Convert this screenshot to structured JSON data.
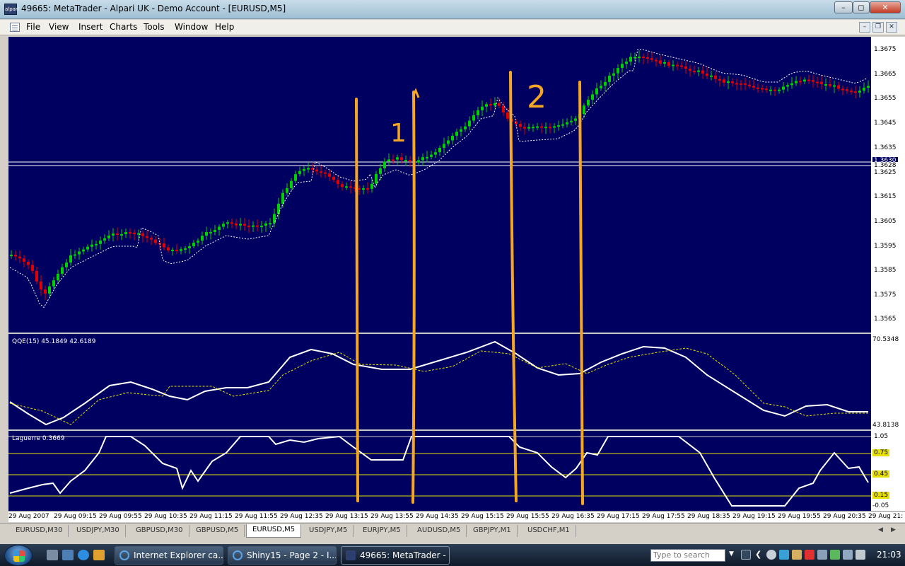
{
  "window": {
    "title": "49665: MetaTrader - Alpari UK - Demo Account - [EURUSD,M5]",
    "app_icon_text": "alpari"
  },
  "menu": [
    "File",
    "View",
    "Insert",
    "Charts",
    "Tools",
    "Window",
    "Help"
  ],
  "price_axis": {
    "labels": [
      "1.3675",
      "1.3665",
      "1.3655",
      "1.3645",
      "1.3635",
      "1.3630",
      "1.3628",
      "1.3625",
      "1.3615",
      "1.3605",
      "1.3595",
      "1.3585",
      "1.3575",
      "1.3565"
    ]
  },
  "qqe": {
    "label": "QQE(15) 45.1849 42.6189",
    "axis_max": "70.5348",
    "axis_min": "43.8138"
  },
  "laguerre": {
    "label": "Laguerre 0.3669",
    "levels": [
      "1.05",
      "0.75",
      "0.45",
      "0.15",
      "-0.05"
    ]
  },
  "time_axis": [
    "29 Aug 2007",
    "29 Aug 09:15",
    "29 Aug 09:55",
    "29 Aug 10:35",
    "29 Aug 11:15",
    "29 Aug 11:55",
    "29 Aug 12:35",
    "29 Aug 13:15",
    "29 Aug 13:55",
    "29 Aug 14:35",
    "29 Aug 15:15",
    "29 Aug 15:55",
    "29 Aug 16:35",
    "29 Aug 17:15",
    "29 Aug 17:55",
    "29 Aug 18:35",
    "29 Aug 19:15",
    "29 Aug 19:55",
    "29 Aug 20:35",
    "29 Aug 21:"
  ],
  "annotations": [
    "1",
    "2"
  ],
  "tabs": [
    {
      "label": "EURUSD,M30",
      "active": false
    },
    {
      "label": "USDJPY,M30",
      "active": false
    },
    {
      "label": "GBPUSD,M30",
      "active": false
    },
    {
      "label": "GBPUSD,M5",
      "active": false
    },
    {
      "label": "EURUSD,M5",
      "active": true
    },
    {
      "label": "USDJPY,M5",
      "active": false
    },
    {
      "label": "EURJPY,M5",
      "active": false
    },
    {
      "label": "AUDUSD,M5",
      "active": false
    },
    {
      "label": "GBPJPY,M1",
      "active": false
    },
    {
      "label": "USDCHF,M1",
      "active": false
    }
  ],
  "taskbar": {
    "tasks": [
      {
        "label": "Internet Explorer ca...",
        "active": false
      },
      {
        "label": "Shiny15 - Page 2 - I...",
        "active": false
      },
      {
        "label": "49665: MetaTrader - ...",
        "active": true
      }
    ],
    "search_placeholder": "Type to search",
    "clock": "21:03"
  },
  "colors": {
    "chart_bg": "#000060",
    "bull": "#00d000",
    "bear": "#e00000",
    "annotation": "#f5a623",
    "level_line": "#e8e000"
  }
}
